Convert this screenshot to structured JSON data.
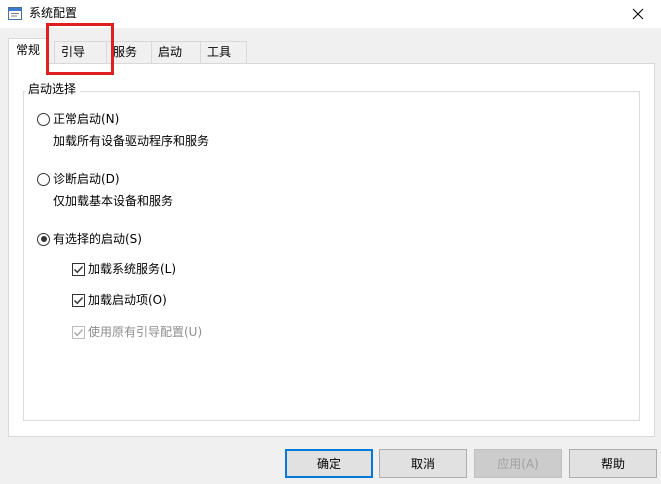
{
  "window": {
    "title": "系统配置",
    "icon": "app-icon",
    "close_icon": "close-icon"
  },
  "tabs": [
    {
      "label": "常规",
      "active": true
    },
    {
      "label": "引导",
      "active": false
    },
    {
      "label": "服务",
      "active": false
    },
    {
      "label": "启动",
      "active": false
    },
    {
      "label": "工具",
      "active": false
    }
  ],
  "startup_selection": {
    "legend": "启动选择",
    "normal": {
      "label": "正常启动(N)",
      "desc": "加载所有设备驱动程序和服务",
      "selected": false
    },
    "diagnostic": {
      "label": "诊断启动(D)",
      "desc": "仅加载基本设备和服务",
      "selected": false
    },
    "selective": {
      "label": "有选择的启动(S)",
      "selected": true,
      "options": [
        {
          "label": "加载系统服务(L)",
          "checked": true,
          "enabled": true
        },
        {
          "label": "加载启动项(O)",
          "checked": true,
          "enabled": true
        },
        {
          "label": "使用原有引导配置(U)",
          "checked": true,
          "enabled": false
        }
      ]
    }
  },
  "buttons": {
    "ok": "确定",
    "cancel": "取消",
    "apply": "应用(A)",
    "help": "帮助"
  },
  "colors": {
    "highlight": "#e02020",
    "focus": "#0078d7"
  }
}
